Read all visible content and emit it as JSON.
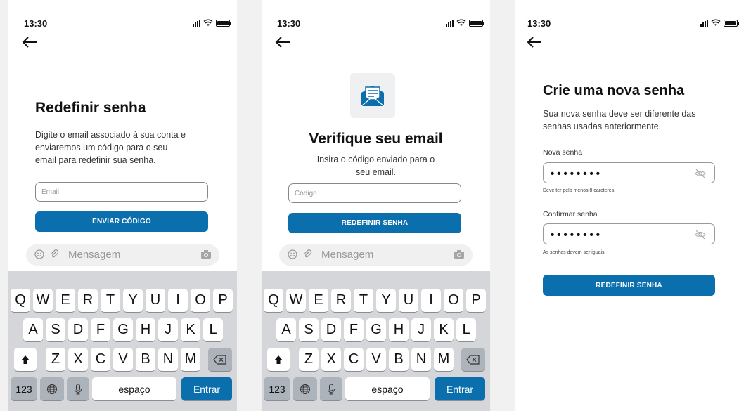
{
  "status": {
    "time": "13:30"
  },
  "colors": {
    "accent": "#0b6fae",
    "keyboard_bg": "#d4d6da"
  },
  "screen1": {
    "title": "Redefinir senha",
    "desc_lines": [
      "Digite o email associado à sua conta e",
      "enviaremos um código para o seu",
      "email para redefinir sua senha."
    ],
    "email_placeholder": "Email",
    "button": "ENVIAR CÓDIGO"
  },
  "screen2": {
    "icon": "envelope-icon",
    "title": "Verifique seu email",
    "desc_lines": [
      "Insira o código enviado para o",
      "seu email."
    ],
    "code_placeholder": "Código",
    "button": "REDEFINIR SENHA"
  },
  "screen3": {
    "title": "Crie uma nova senha",
    "desc_lines": [
      "Sua nova senha deve ser diferente das",
      "senhas usadas anteriormente."
    ],
    "new_label": "Nova senha",
    "new_value": "••••••••",
    "new_hint": "Deve ter pelo menos 8 carcteres.",
    "confirm_label": "Confirmar senha",
    "confirm_value": "••••••••",
    "confirm_hint": "As senhas devem ser iguais.",
    "button": "REDEFINIR SENHA"
  },
  "message_bar": {
    "placeholder": "Mensagem"
  },
  "keyboard": {
    "row1": [
      "Q",
      "W",
      "E",
      "R",
      "T",
      "Y",
      "U",
      "I",
      "O",
      "P"
    ],
    "row2": [
      "A",
      "S",
      "D",
      "F",
      "G",
      "H",
      "J",
      "K",
      "L"
    ],
    "row3": [
      "Z",
      "X",
      "C",
      "V",
      "B",
      "N",
      "M"
    ],
    "numbers": "123",
    "space": "espaço",
    "enter": "Entrar"
  }
}
